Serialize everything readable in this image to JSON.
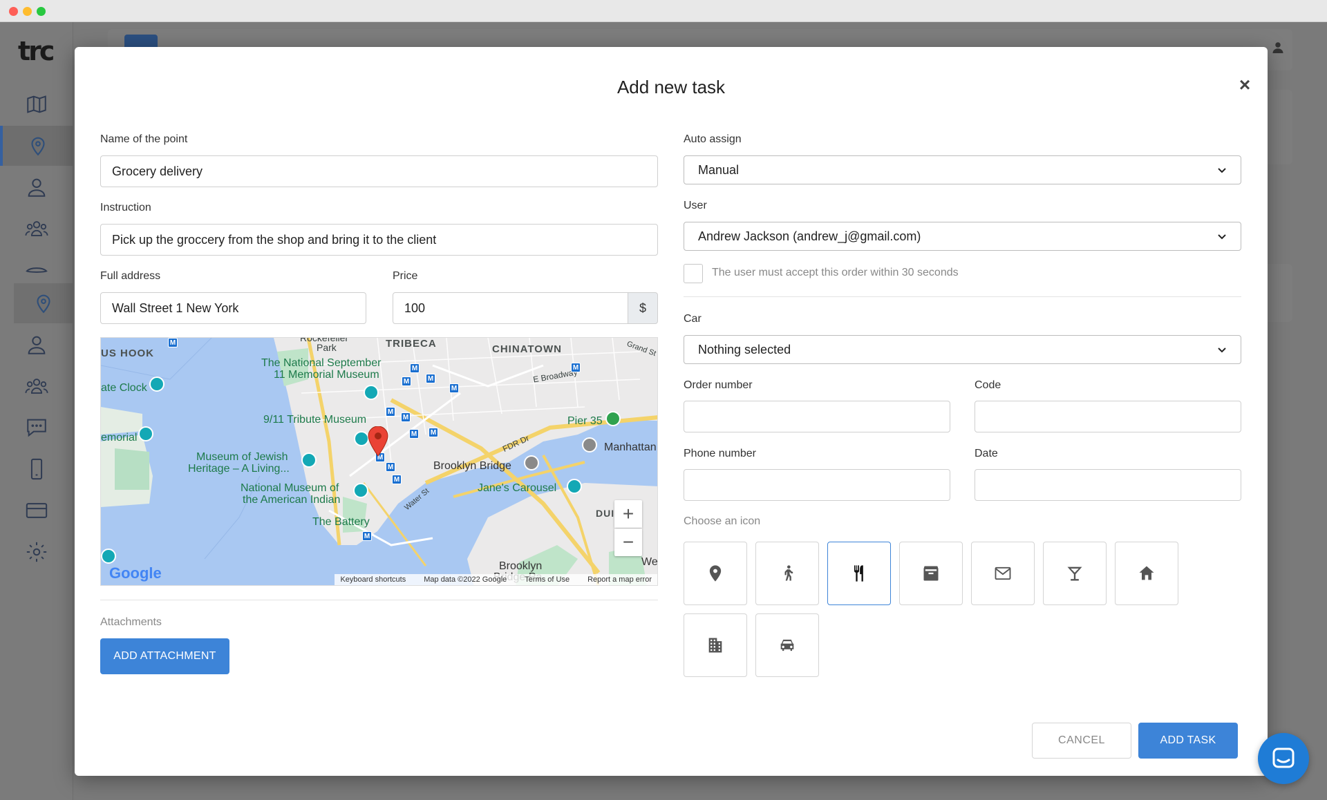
{
  "app": {
    "logo": "trc"
  },
  "modal": {
    "title": "Add new task",
    "close": "×"
  },
  "form": {
    "name_label": "Name of the point",
    "name_value": "Grocery delivery",
    "instruction_label": "Instruction",
    "instruction_value": "Pick up the groccery from the shop and bring it to the client",
    "address_label": "Full address",
    "address_value": "Wall Street 1 New York",
    "price_label": "Price",
    "price_value": "100",
    "price_currency": "$",
    "auto_assign_label": "Auto assign",
    "auto_assign_value": "Manual",
    "user_label": "User",
    "user_value": "Andrew Jackson (andrew_j@gmail.com)",
    "accept_label": "The user must accept this order within 30 seconds",
    "car_label": "Car",
    "car_value": "Nothing selected",
    "order_number_label": "Order number",
    "order_number_value": "",
    "code_label": "Code",
    "code_value": "",
    "phone_label": "Phone number",
    "phone_value": "",
    "date_label": "Date",
    "date_value": "",
    "icon_label": "Choose an icon",
    "attachments_label": "Attachments",
    "add_attachment": "ADD ATTACHMENT",
    "cancel": "CANCEL",
    "add_task": "ADD TASK"
  },
  "icons": [
    {
      "name": "location-pin-icon",
      "selected": false
    },
    {
      "name": "person-walking-icon",
      "selected": false
    },
    {
      "name": "fork-knife-icon",
      "selected": true
    },
    {
      "name": "archive-box-icon",
      "selected": false
    },
    {
      "name": "envelope-icon",
      "selected": false
    },
    {
      "name": "cocktail-icon",
      "selected": false
    },
    {
      "name": "home-icon",
      "selected": false
    },
    {
      "name": "building-icon",
      "selected": false
    },
    {
      "name": "car-icon",
      "selected": false
    }
  ],
  "map": {
    "labels": {
      "lushook": "US HOOK",
      "tribeca": "TRIBECA",
      "chinatown": "CHINATOWN",
      "rockefeller": "Rockefeller",
      "park": "Park",
      "grand_st": "Grand St",
      "memorial1": "The National September",
      "memorial2": "11 Memorial Museum",
      "e_broadway": "E Broadway",
      "clock": "ate Clock",
      "tribute": "9/11 Tribute Museum",
      "pier35": "Pier 35",
      "fdr": "FDR Dr",
      "manhattan": "Manhattan",
      "emorial": "emorial",
      "jewish1": "Museum of Jewish",
      "jewish2": "Heritage – A Living...",
      "brooklyn_bridge": "Brooklyn Bridge",
      "nmai1": "National Museum of",
      "nmai2": "the American Indian",
      "carousel": "Jane's Carousel",
      "water_st": "Water St",
      "battery": "The Battery",
      "dui": "DUI",
      "brooklyn": "Brooklyn",
      "bridge_park": "Bridge Pa",
      "we": "We",
      "zoom_in": "+",
      "zoom_out": "−",
      "google": "Google",
      "shortcuts": "Keyboard shortcuts",
      "mapdata": "Map data ©2022 Google",
      "terms": "Terms of Use",
      "report": "Report a map error"
    }
  },
  "colors": {
    "primary": "#3d84d8",
    "sidebar_active": "#3560a0",
    "chat": "#1f7cd6"
  }
}
